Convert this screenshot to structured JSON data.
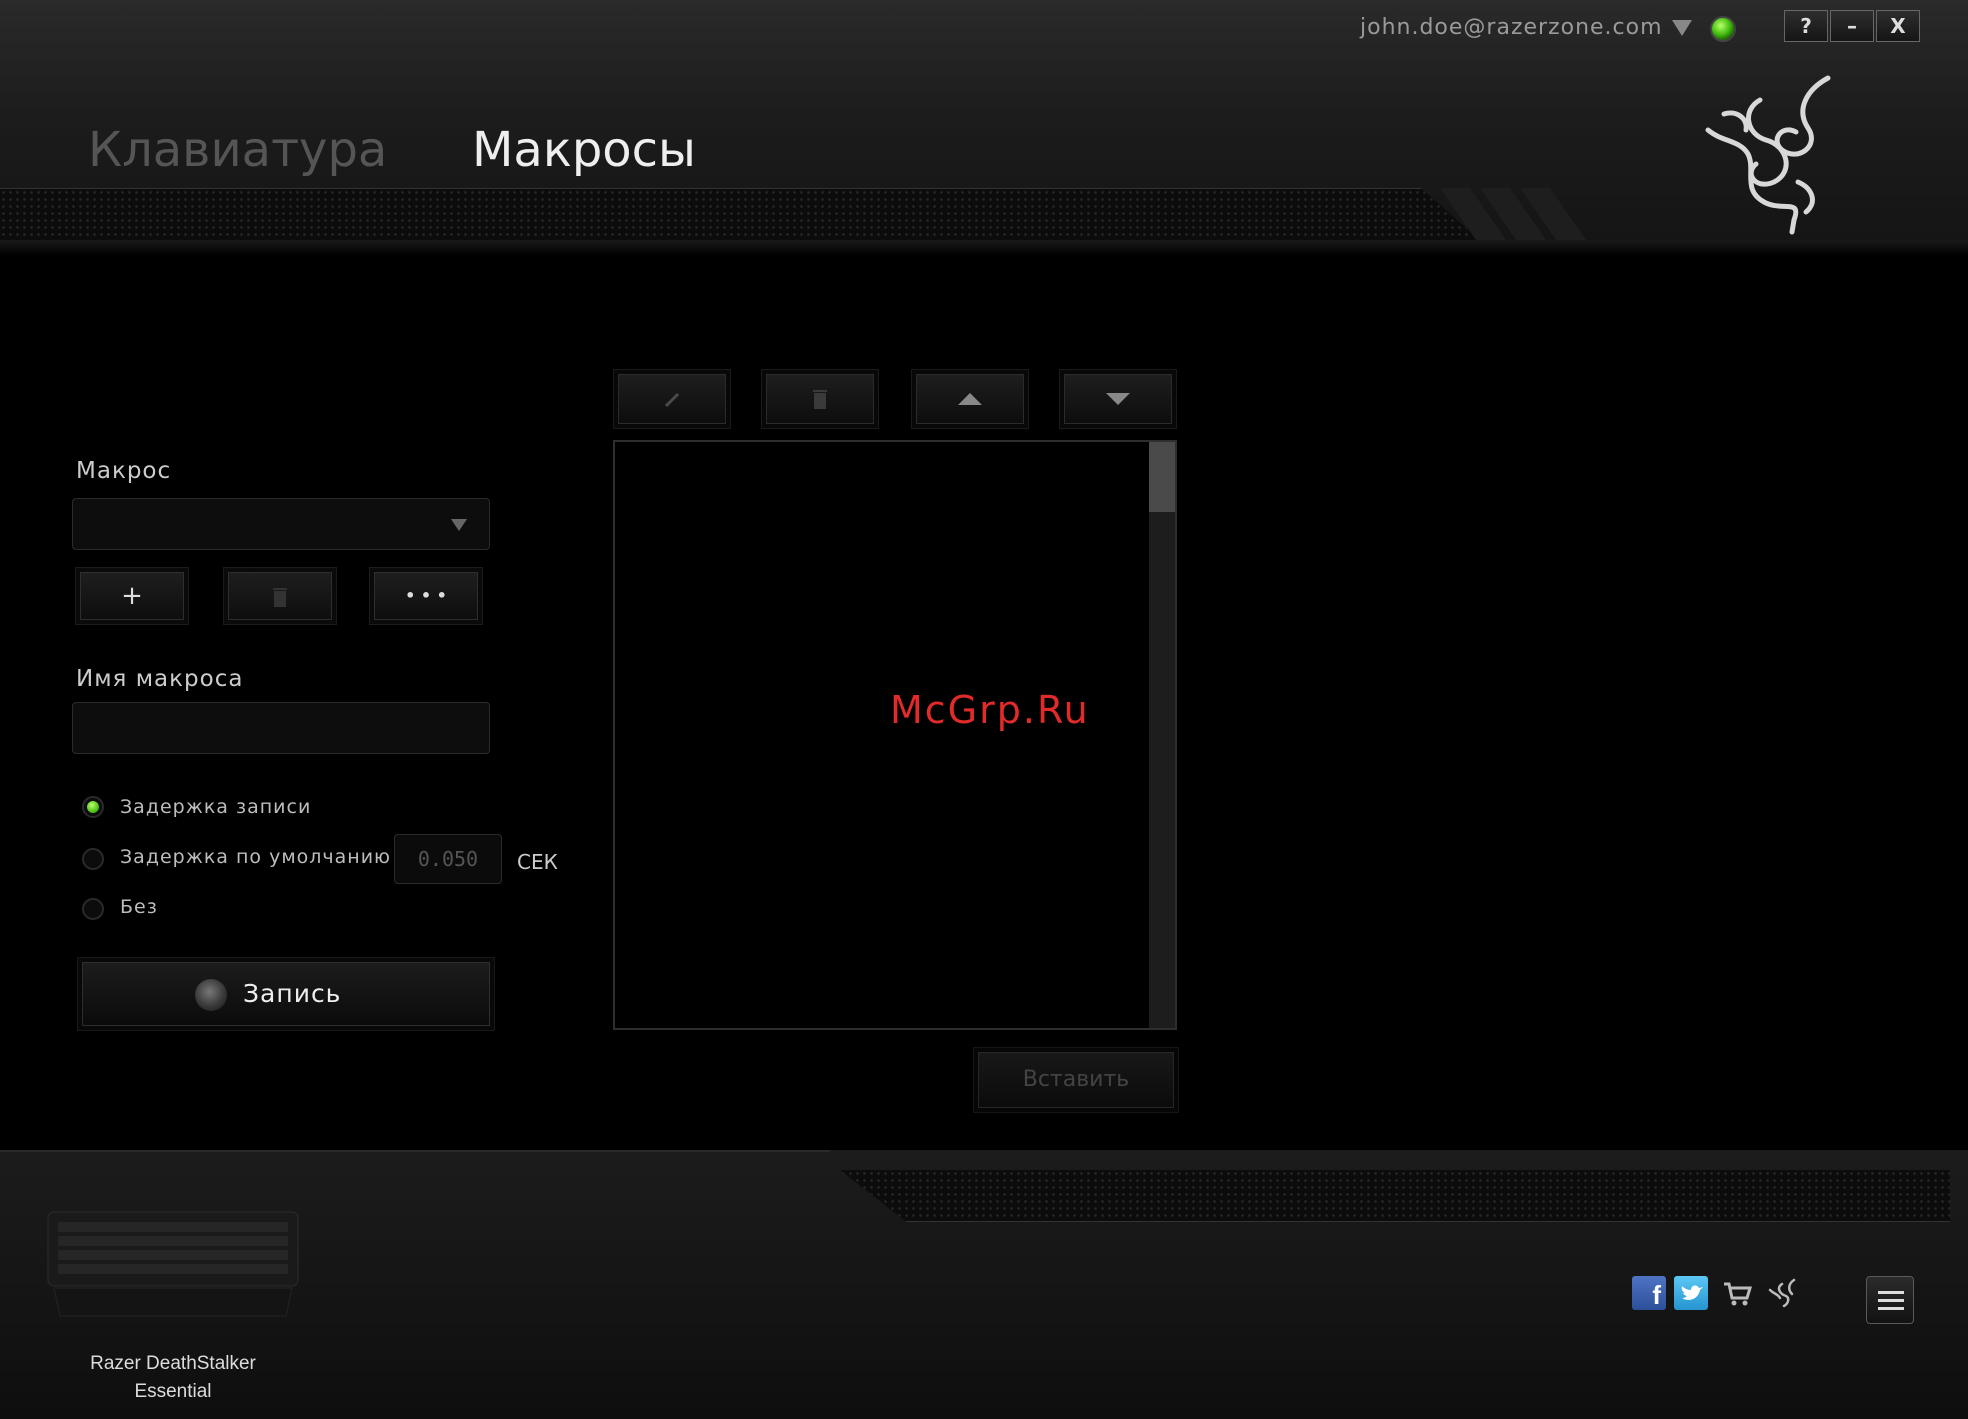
{
  "account": {
    "email": "john.doe@razerzone.com",
    "status_color": "#44c010"
  },
  "window_controls": {
    "help": "?",
    "minimize": "–",
    "close": "X"
  },
  "tabs": [
    {
      "label": "Клавиатура",
      "active": false
    },
    {
      "label": "Макросы",
      "active": true
    }
  ],
  "macro_panel": {
    "macro_label": "Макрос",
    "macro_selected": "",
    "add_button": "+",
    "more_button": "• • •",
    "name_label": "Имя макроса",
    "name_value": "",
    "delay_options": [
      {
        "label": "Задержка записи",
        "selected": true
      },
      {
        "label": "Задержка по умолчанию",
        "selected": false
      },
      {
        "label": "Без",
        "selected": false
      }
    ],
    "default_delay_value": "0.050",
    "delay_unit": "СЕК",
    "record_button": "Запись"
  },
  "editor": {
    "tools": [
      "edit-icon",
      "trash-icon",
      "arrow-up-icon",
      "arrow-down-icon"
    ],
    "items": [],
    "insert_button": "Вставить"
  },
  "watermark": "McGrp.Ru",
  "device": {
    "name_line1": "Razer DeathStalker",
    "name_line2": "Essential"
  },
  "social": [
    "facebook-icon",
    "twitter-icon",
    "cart-icon",
    "razer-icon"
  ],
  "colors": {
    "accent_green": "#44c010",
    "watermark_red": "#e12a2a"
  }
}
